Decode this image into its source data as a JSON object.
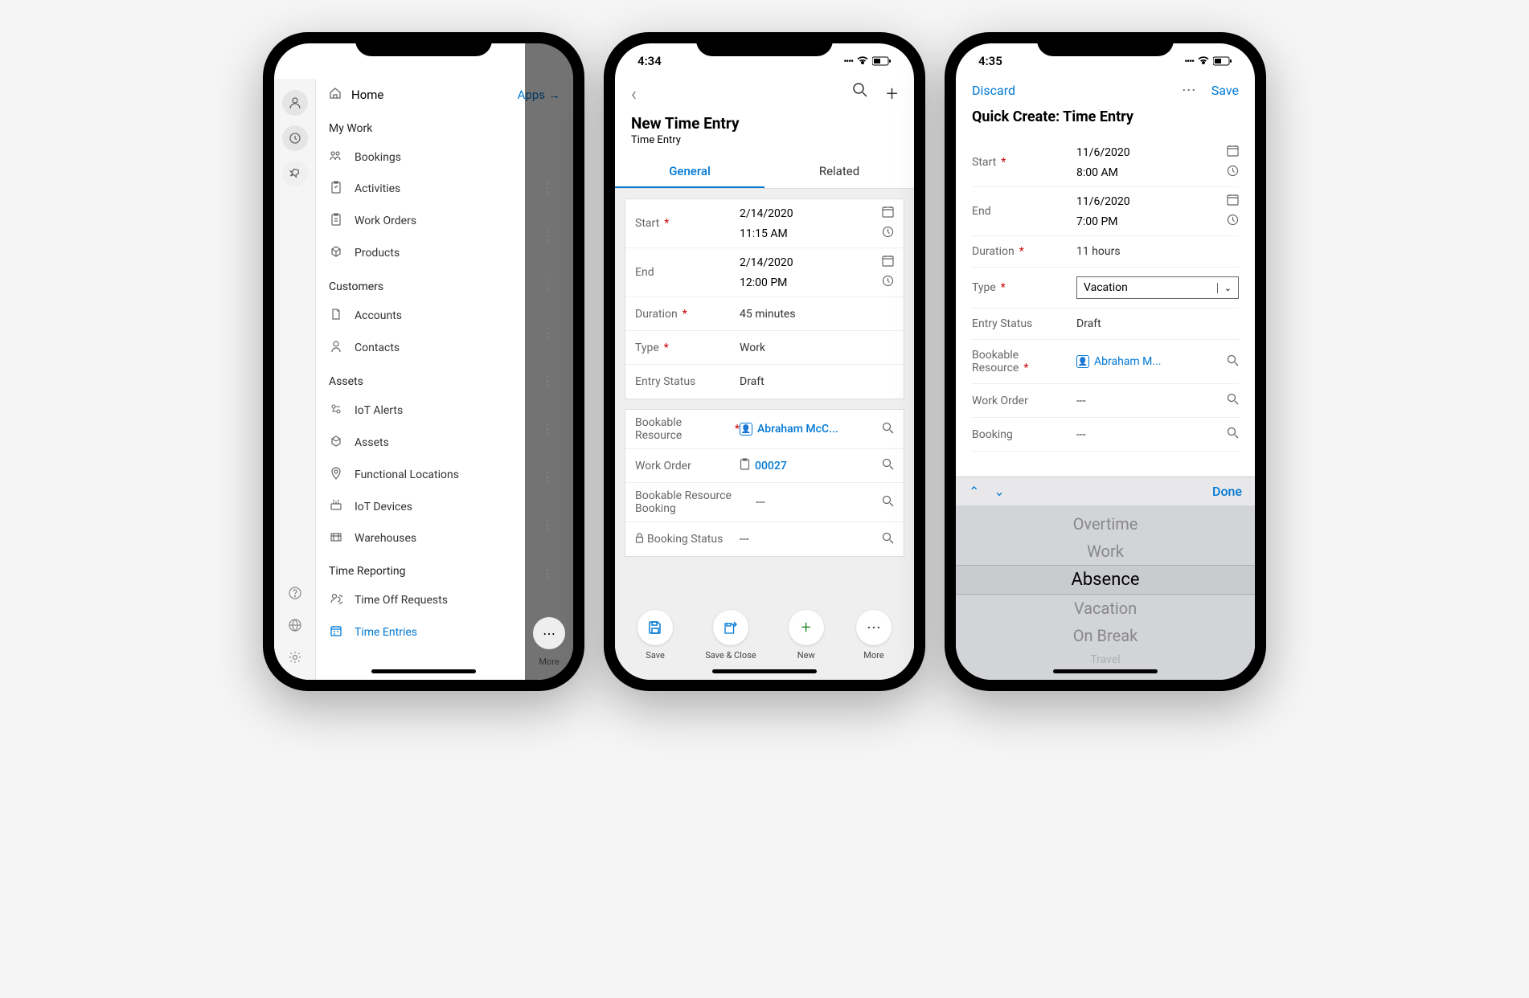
{
  "phone1": {
    "drawer": {
      "home": "Home",
      "apps": "Apps",
      "sections": [
        {
          "title": "My Work",
          "items": [
            "Bookings",
            "Activities",
            "Work Orders",
            "Products"
          ]
        },
        {
          "title": "Customers",
          "items": [
            "Accounts",
            "Contacts"
          ]
        },
        {
          "title": "Assets",
          "items": [
            "IoT Alerts",
            "Assets",
            "Functional Locations",
            "IoT Devices",
            "Warehouses"
          ]
        },
        {
          "title": "Time Reporting",
          "items": [
            "Time Off Requests",
            "Time Entries"
          ]
        }
      ],
      "active": "Time Entries",
      "bg_more": "More"
    }
  },
  "phone2": {
    "time": "4:34",
    "title": "New Time Entry",
    "subtitle": "Time Entry",
    "tabs": {
      "general": "General",
      "related": "Related"
    },
    "fields": {
      "start": {
        "label": "Start",
        "date": "2/14/2020",
        "time": "11:15 AM"
      },
      "end": {
        "label": "End",
        "date": "2/14/2020",
        "time": "12:00 PM"
      },
      "duration": {
        "label": "Duration",
        "value": "45 minutes"
      },
      "type": {
        "label": "Type",
        "value": "Work"
      },
      "entryStatus": {
        "label": "Entry Status",
        "value": "Draft"
      },
      "bookableResource": {
        "label": "Bookable Resource",
        "value": "Abraham McC..."
      },
      "workOrder": {
        "label": "Work Order",
        "value": "00027"
      },
      "bookableResourceBooking": {
        "label": "Bookable Resource Booking",
        "value": "---"
      },
      "bookingStatus": {
        "label": "Booking Status",
        "value": "---"
      }
    },
    "bottom": {
      "save": "Save",
      "saveClose": "Save & Close",
      "new": "New",
      "more": "More"
    }
  },
  "phone3": {
    "time": "4:35",
    "discard": "Discard",
    "save": "Save",
    "title": "Quick Create: Time Entry",
    "fields": {
      "start": {
        "label": "Start",
        "date": "11/6/2020",
        "time": "8:00 AM"
      },
      "end": {
        "label": "End",
        "date": "11/6/2020",
        "time": "7:00 PM"
      },
      "duration": {
        "label": "Duration",
        "value": "11 hours"
      },
      "type": {
        "label": "Type",
        "value": "Vacation"
      },
      "entryStatus": {
        "label": "Entry Status",
        "value": "Draft"
      },
      "bookableResource": {
        "label": "Bookable Resource",
        "value": "Abraham M..."
      },
      "workOrder": {
        "label": "Work Order",
        "value": "---"
      },
      "booking": {
        "label": "Booking",
        "value": "---"
      }
    },
    "keyboardBar": {
      "done": "Done"
    },
    "picker": {
      "options": [
        "Overtime",
        "Work",
        "Absence",
        "Vacation",
        "On Break",
        "Travel"
      ],
      "selected": "Absence"
    }
  }
}
